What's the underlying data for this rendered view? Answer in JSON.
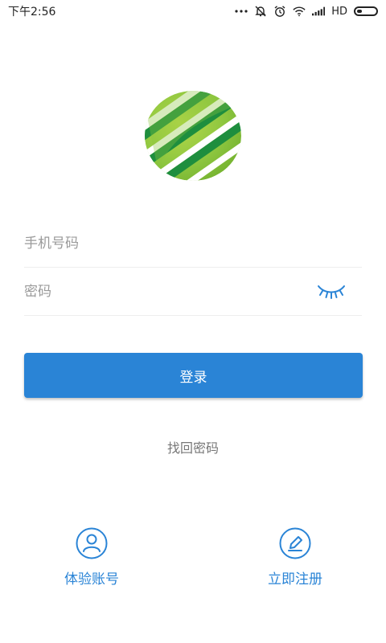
{
  "status_bar": {
    "time": "下午2:56",
    "network": "HD",
    "battery_level": 0.25
  },
  "logo": {
    "icon": "striped-globe-logo",
    "colors": [
      "#8dc63f",
      "#1e8e3e",
      "#ffffff"
    ]
  },
  "form": {
    "phone_placeholder": "手机号码",
    "password_placeholder": "密码",
    "eye_icon": "closed-eye-icon"
  },
  "login": {
    "label": "登录"
  },
  "forgot": {
    "label": "找回密码"
  },
  "bottom": {
    "trial": {
      "label": "体验账号",
      "icon": "user-icon"
    },
    "register": {
      "label": "立即注册",
      "icon": "pencil-icon"
    }
  },
  "colors": {
    "accent": "#2a84d6",
    "text_muted": "#777777",
    "placeholder": "#9a9a9a"
  }
}
